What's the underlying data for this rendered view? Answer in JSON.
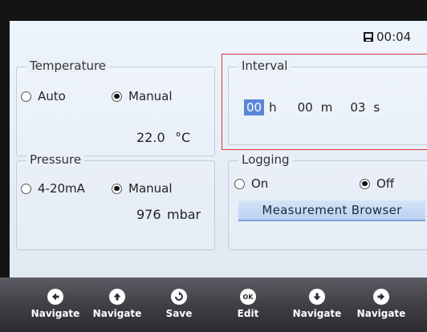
{
  "status": {
    "time": "00:04",
    "icon": "memory-card-icon"
  },
  "temperature": {
    "title": "Temperature",
    "auto_label": "Auto",
    "manual_label": "Manual",
    "mode": "Manual",
    "value": "22.0",
    "unit": "°C"
  },
  "interval": {
    "title": "Interval",
    "hours": "00",
    "hours_unit": "h",
    "minutes": "00",
    "minutes_unit": "m",
    "seconds": "03",
    "seconds_unit": "s"
  },
  "pressure": {
    "title": "Pressure",
    "option1_label": "4-20mA",
    "manual_label": "Manual",
    "mode": "Manual",
    "value": "976",
    "unit": "mbar"
  },
  "logging": {
    "title": "Logging",
    "on_label": "On",
    "off_label": "Off",
    "state": "Off",
    "browser_label": "Measurement Browser"
  },
  "navbar": {
    "buttons": [
      {
        "label": "Navigate",
        "icon": "arrow-left-icon"
      },
      {
        "label": "Navigate",
        "icon": "arrow-up-icon"
      },
      {
        "label": "Save",
        "icon": "save-icon"
      },
      {
        "label": "Edit",
        "icon": "ok-icon",
        "glyph": "OK"
      },
      {
        "label": "Navigate",
        "icon": "arrow-down-icon"
      },
      {
        "label": "Navigate",
        "icon": "arrow-right-icon"
      }
    ]
  },
  "colors": {
    "highlight_border": "#d9363a",
    "selection": "#5b86d8",
    "navbar": "#3d3d44"
  }
}
